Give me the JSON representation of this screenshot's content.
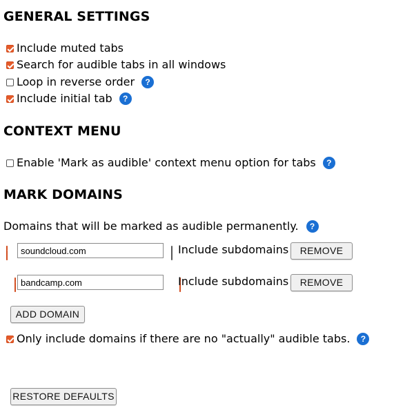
{
  "general": {
    "title": "GENERAL SETTINGS",
    "items": [
      {
        "label": "Include muted tabs",
        "checked": true
      },
      {
        "label": "Search for audible tabs in all windows",
        "checked": true
      },
      {
        "label": "Loop in reverse order",
        "checked": false
      },
      {
        "label": "Include initial tab",
        "checked": true
      }
    ]
  },
  "context_menu": {
    "title": "CONTEXT MENU",
    "items": [
      {
        "label": "Enable 'Mark as audible' context menu option for tabs",
        "checked": false
      }
    ]
  },
  "mark_domains": {
    "title": "MARK DOMAINS",
    "description": "Domains that will be marked as audible permanently.",
    "domains": [
      {
        "enabled": true,
        "value": "soundcloud.com",
        "subdomains_label": "Include subdomains",
        "include_subdomains": false,
        "remove_label": "REMOVE"
      },
      {
        "enabled": true,
        "value": "bandcamp.com",
        "subdomains_label": "Include subdomains",
        "include_subdomains": true,
        "remove_label": "REMOVE"
      }
    ],
    "add_label": "ADD DOMAIN",
    "only_if_none": {
      "label": "Only include domains if there are no \"actually\" audible tabs.",
      "checked": true
    }
  },
  "restore_label": "RESTORE DEFAULTS",
  "help_glyph": "?",
  "colors": {
    "accent": "#e55b2a",
    "help": "#1a6fd3"
  }
}
